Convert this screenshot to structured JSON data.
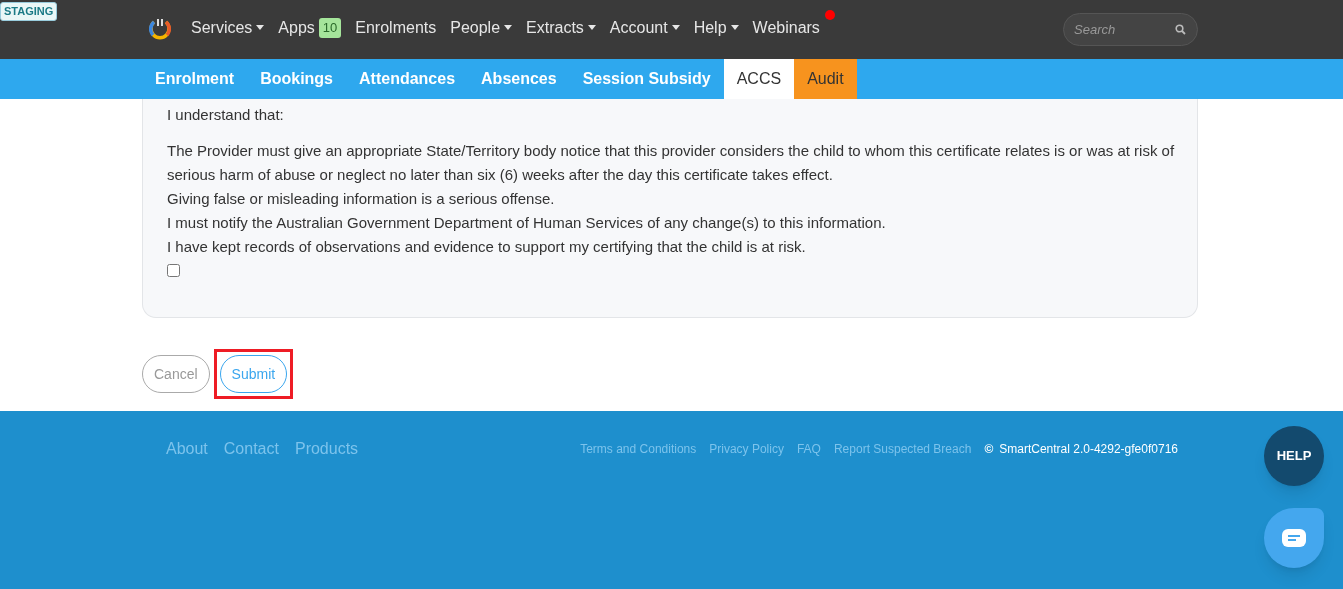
{
  "staging_badge": "STAGING",
  "nav": {
    "items": [
      {
        "label": "Services",
        "dropdown": true
      },
      {
        "label": "Apps",
        "dropdown": false,
        "badge": "10"
      },
      {
        "label": "Enrolments",
        "dropdown": false
      },
      {
        "label": "People",
        "dropdown": true
      },
      {
        "label": "Extracts",
        "dropdown": true
      },
      {
        "label": "Account",
        "dropdown": true
      },
      {
        "label": "Help",
        "dropdown": true
      },
      {
        "label": "Webinars",
        "dropdown": false,
        "notification": true
      }
    ],
    "search": {
      "placeholder": "Search"
    }
  },
  "tabs": [
    {
      "label": "Enrolment",
      "selected": false,
      "highlighted": false
    },
    {
      "label": "Bookings",
      "selected": false,
      "highlighted": false
    },
    {
      "label": "Attendances",
      "selected": false,
      "highlighted": false
    },
    {
      "label": "Absences",
      "selected": false,
      "highlighted": false
    },
    {
      "label": "Session Subsidy",
      "selected": false,
      "highlighted": false
    },
    {
      "label": "ACCS",
      "selected": true,
      "highlighted": false
    },
    {
      "label": "Audit",
      "selected": false,
      "highlighted": true
    }
  ],
  "declaration": {
    "intro": "I understand that:",
    "statements": [
      "The Provider must give an appropriate State/Territory body notice that this provider considers the child to whom this certificate relates is or was at risk of serious harm of abuse or neglect no later than six (6) weeks after the day this certificate takes effect.",
      "Giving false or misleading information is a serious offense.",
      "I must notify the Australian Government Department of Human Services of any change(s) to this information.",
      "I have kept records of observations and evidence to support my certifying that the child is at risk."
    ],
    "checked": false
  },
  "buttons": [
    {
      "label": "Cancel",
      "kind": "secondary",
      "annotated": false
    },
    {
      "label": "Submit",
      "kind": "primary",
      "annotated": true
    }
  ],
  "footer": {
    "links": [
      "About",
      "Contact",
      "Products"
    ],
    "small_links": [
      "Terms and Conditions",
      "Privacy Policy",
      "FAQ",
      "Report Suspected Breach"
    ],
    "copyright_symbol": "©",
    "version": "SmartCentral 2.0-4292-gfe0f0716"
  },
  "help_button": "HELP"
}
